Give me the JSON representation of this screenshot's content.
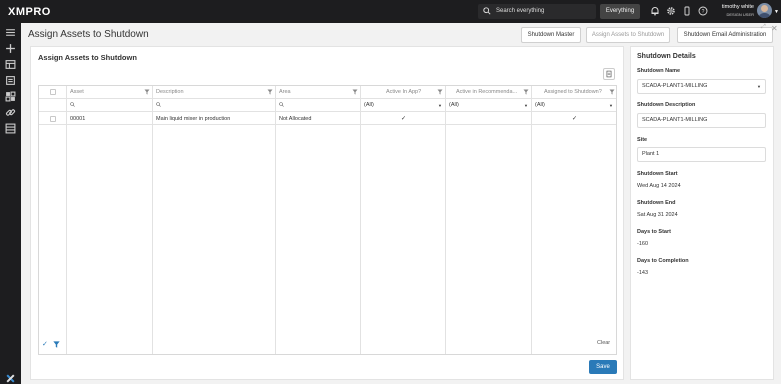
{
  "app": {
    "logo": "XMPRO"
  },
  "topbar": {
    "search_placeholder": "Search everything",
    "scope": "Everything",
    "user_name": "timothy white",
    "user_role": "DESIGN USER"
  },
  "header": {
    "title": "Assign Assets to Shutdown",
    "buttons": [
      "Shutdown Master",
      "Assign Assets to Shutdown",
      "Shutdown Email Administration"
    ]
  },
  "grid": {
    "title": "Assign Assets to Shutdown",
    "columns": [
      "Asset",
      "Description",
      "Area",
      "Active In App?",
      "Active in Recommenda...",
      "Assigned to Shutdown?"
    ],
    "filter_all": "(All)",
    "rows": [
      {
        "asset": "00001",
        "description": "Main liquid mixer in production",
        "area": "Not Allocated",
        "active_in_app": true,
        "active_in_rec": false,
        "assigned": true
      }
    ],
    "clear_label": "Clear",
    "save_label": "Save"
  },
  "details": {
    "title": "Shutdown Details",
    "name_label": "Shutdown Name",
    "name_value": "SCADA-PLANT1-MILLING",
    "desc_label": "Shutdown Description",
    "desc_value": "SCADA-PLANT1-MILLING",
    "site_label": "Site",
    "site_value": "Plant 1",
    "start_label": "Shutdown Start",
    "start_value": "Wed Aug 14 2024",
    "end_label": "Shutdown End",
    "end_value": "Sat Aug 31 2024",
    "days_start_label": "Days to Start",
    "days_start_value": "-160",
    "days_completion_label": "Days to Completion",
    "days_completion_value": "-143"
  },
  "colors": {
    "accent": "#2a7ab8",
    "topbar": "#1d1d1f"
  }
}
